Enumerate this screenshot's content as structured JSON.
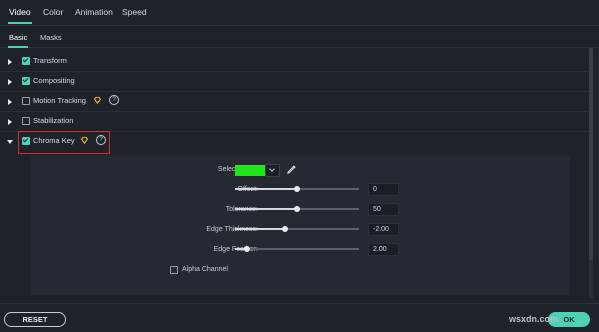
{
  "tabs": {
    "video": "Video",
    "color": "Color",
    "animation": "Animation",
    "speed": "Speed"
  },
  "subtabs": {
    "basic": "Basic",
    "masks": "Masks"
  },
  "sections": {
    "transform": {
      "label": "Transform",
      "checked": true
    },
    "compositing": {
      "label": "Compositing",
      "checked": true
    },
    "motion_tracking": {
      "label": "Motion Tracking",
      "checked": false,
      "premium": true,
      "help": "?"
    },
    "stabilization": {
      "label": "Stabilization",
      "checked": false
    },
    "chroma_key": {
      "label": "Chroma Key",
      "checked": true,
      "premium": true,
      "help": "?",
      "expanded": true
    }
  },
  "chroma": {
    "select_color_label": "Select Color:",
    "selected_color": "#22e51b",
    "offset": {
      "label": "Offset:",
      "value": "0",
      "position": 0.5
    },
    "tolerance": {
      "label": "Tolerance:",
      "value": "50",
      "position": 0.5
    },
    "edge_thickness": {
      "label": "Edge Thickness:",
      "value": "-2.00",
      "position": 0.4
    },
    "edge_feather": {
      "label": "Edge Feather:",
      "value": "2.00",
      "position": 0.1
    },
    "alpha_channel": {
      "label": "Alpha Channel",
      "checked": false
    }
  },
  "buttons": {
    "reset": "RESET",
    "ok": "OK"
  },
  "watermark": "wsxdn.com",
  "colors": {
    "accent": "#4fd1b8",
    "highlight": "#d62d2d",
    "premium": "#f2b632"
  }
}
